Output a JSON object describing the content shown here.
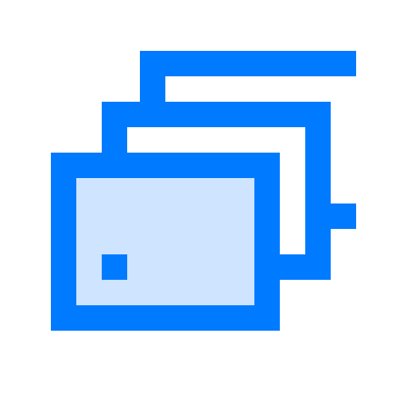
{
  "icon": {
    "name": "stacked-cards-icon",
    "colors": {
      "stroke": "#007AFF",
      "fill_front": "#CFE4FF",
      "background": "#FFFFFF"
    },
    "card_count": 3
  }
}
